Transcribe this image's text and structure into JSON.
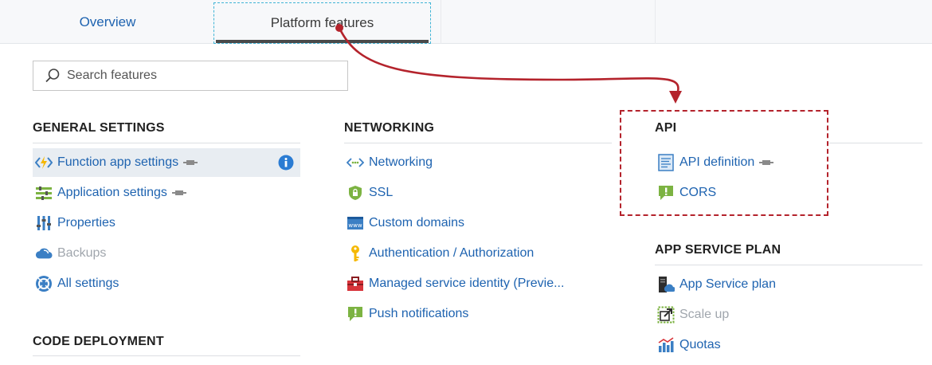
{
  "tabs": [
    {
      "label": "Overview"
    },
    {
      "label": "Platform features"
    }
  ],
  "search": {
    "placeholder": "Search features"
  },
  "sections": {
    "general": {
      "title": "GENERAL SETTINGS",
      "items": [
        {
          "label": "Function app settings",
          "icon": "function-icon"
        },
        {
          "label": "Application settings",
          "icon": "settings-list-icon"
        },
        {
          "label": "Properties",
          "icon": "properties-icon"
        },
        {
          "label": "Backups",
          "icon": "cloud-backup-icon"
        },
        {
          "label": "All settings",
          "icon": "globe-settings-icon"
        }
      ]
    },
    "code_deployment": {
      "title": "CODE DEPLOYMENT"
    },
    "networking": {
      "title": "NETWORKING",
      "items": [
        {
          "label": "Networking",
          "icon": "networking-icon"
        },
        {
          "label": "SSL",
          "icon": "ssl-shield-icon"
        },
        {
          "label": "Custom domains",
          "icon": "www-icon"
        },
        {
          "label": "Authentication / Authorization",
          "icon": "key-icon"
        },
        {
          "label": "Managed service identity (Previe...",
          "icon": "toolbox-icon"
        },
        {
          "label": "Push notifications",
          "icon": "notification-icon"
        }
      ]
    },
    "api": {
      "title": "API",
      "items": [
        {
          "label": "API definition",
          "icon": "api-document-icon"
        },
        {
          "label": "CORS",
          "icon": "cors-icon"
        }
      ]
    },
    "app_service_plan": {
      "title": "APP SERVICE PLAN",
      "items": [
        {
          "label": "App Service plan",
          "icon": "app-service-plan-icon"
        },
        {
          "label": "Scale up",
          "icon": "scale-up-icon"
        },
        {
          "label": "Quotas",
          "icon": "quotas-icon"
        }
      ]
    }
  },
  "colors": {
    "link": "#1e63b0",
    "disabled": "#a0a6ad",
    "annotation": "#b4232c",
    "tab_highlight": "#3fb4d6"
  }
}
